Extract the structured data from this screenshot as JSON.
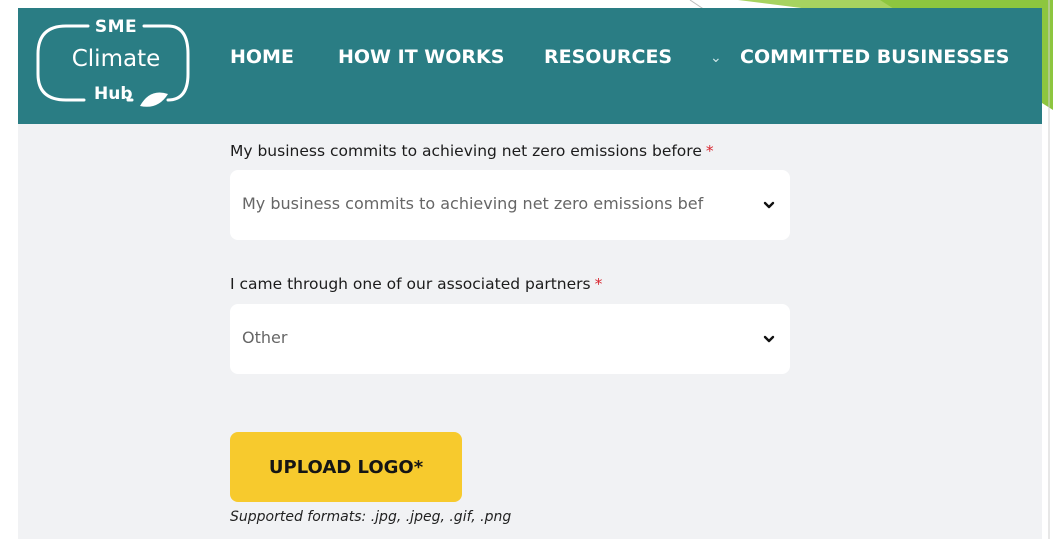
{
  "logo": {
    "line1": "SME",
    "line2": "Climate",
    "line3": "Hub"
  },
  "nav": {
    "home": "HOME",
    "how_it_works": "HOW IT WORKS",
    "resources": "RESOURCES",
    "resources_chevron": "⌄",
    "committed_businesses": "COMMITTED BUSINESSES"
  },
  "form": {
    "net_zero": {
      "label": "My business commits to achieving net zero emissions before",
      "required_mark": "*",
      "value": "My business commits to achieving net zero emissions bef"
    },
    "partner": {
      "label": "I came through one of our associated partners",
      "required_mark": "*",
      "value": "Other"
    },
    "upload_button": "UPLOAD LOGO*",
    "supported_formats": "Supported formats: .jpg, .jpeg, .gif, .png"
  },
  "colors": {
    "header": "#2a7d84",
    "upload_button": "#f7ca2d",
    "required": "#d8262f",
    "decoration_green": "#8dc63f"
  }
}
